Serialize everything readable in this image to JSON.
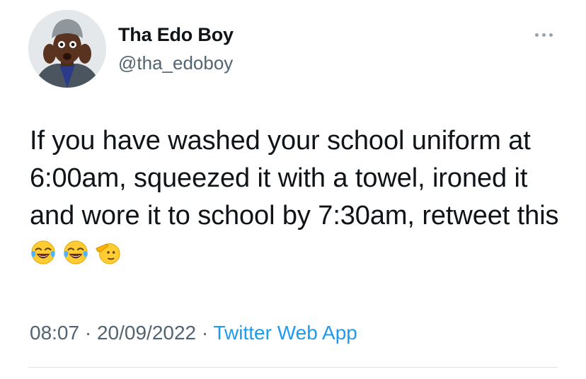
{
  "user": {
    "display_name": "Tha Edo Boy",
    "handle": "@tha_edoboy"
  },
  "tweet": {
    "text": "If you have washed your school uniform at 6:00am, squeezed it with a towel, ironed it and wore it to school by 7:30am, retweet this ",
    "emojis": [
      "face-with-tears-of-joy",
      "face-with-tears-of-joy",
      "saluting-face"
    ]
  },
  "meta": {
    "time": "08:07",
    "separator": "·",
    "date": "20/09/2022",
    "source": "Twitter Web App"
  },
  "colors": {
    "text": "#0f1419",
    "secondary": "#536471",
    "link": "#1d9bf0",
    "divider": "#dfe4e8"
  }
}
